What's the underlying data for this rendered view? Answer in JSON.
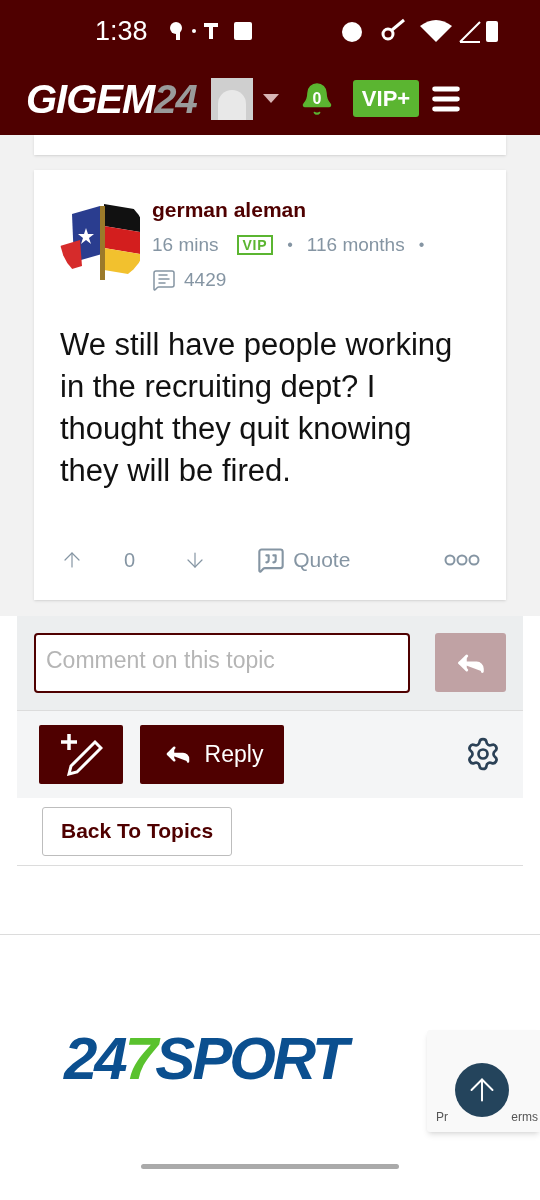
{
  "status_bar": {
    "time": "1:38"
  },
  "header": {
    "logo_main": "GIGEM",
    "logo_suffix": "24",
    "notifications": "0",
    "vip_button": "VIP+"
  },
  "post": {
    "author": "german aleman",
    "time": "16 mins",
    "badge": "VIP",
    "separators": [
      "•",
      "•"
    ],
    "tenure": "116 months",
    "post_count": "4429",
    "body": "We still have people working in the recruiting dept? I thought they quit knowing they will be fired.",
    "score": "0",
    "quote_label": "Quote"
  },
  "comment": {
    "placeholder": "Comment on this topic"
  },
  "actions": {
    "reply_label": "Reply",
    "back_label": "Back To Topics"
  },
  "footer": {
    "logo_digits": "24",
    "logo_seven": "7",
    "logo_word": "SPORT",
    "recaptcha_texts": [
      "Pr",
      "erms"
    ]
  }
}
